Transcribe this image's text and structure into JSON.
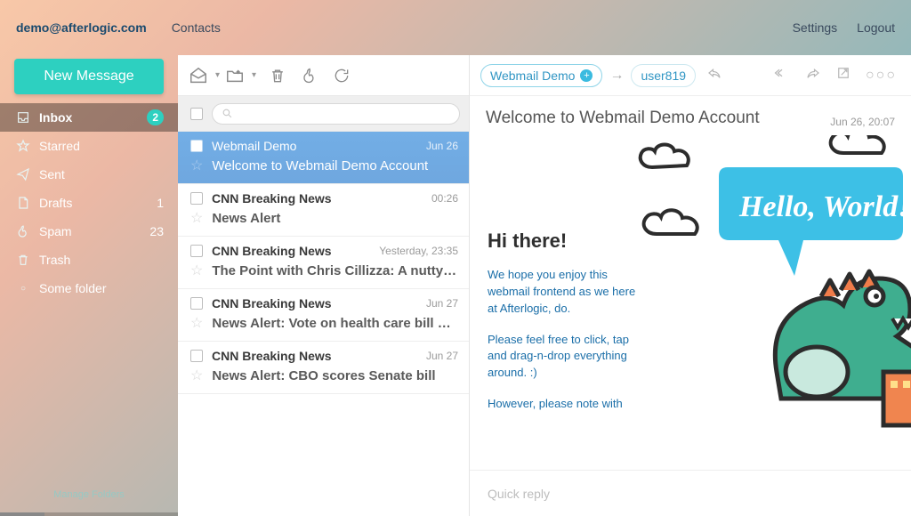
{
  "header": {
    "email": "demo@afterlogic.com",
    "contacts": "Contacts",
    "settings": "Settings",
    "logout": "Logout"
  },
  "sidebar": {
    "new_message": "New Message",
    "manage": "Manage Folders",
    "folders": [
      {
        "icon": "inbox",
        "label": "Inbox",
        "badge": "2",
        "selected": true
      },
      {
        "icon": "star",
        "label": "Starred",
        "badge": "",
        "selected": false
      },
      {
        "icon": "send",
        "label": "Sent",
        "badge": "",
        "selected": false
      },
      {
        "icon": "draft",
        "label": "Drafts",
        "badge": "",
        "count": "1",
        "selected": false
      },
      {
        "icon": "spam",
        "label": "Spam",
        "badge": "",
        "count": "23",
        "selected": false
      },
      {
        "icon": "trash",
        "label": "Trash",
        "badge": "",
        "selected": false
      },
      {
        "icon": "dot",
        "label": "Some folder",
        "badge": "",
        "selected": false
      }
    ]
  },
  "list": {
    "search_placeholder": "",
    "messages": [
      {
        "from": "Webmail Demo",
        "date": "Jun 26",
        "subject": "Welcome to Webmail Demo Account",
        "selected": true
      },
      {
        "from": "CNN Breaking News",
        "date": "00:26",
        "subject": "News Alert",
        "selected": false
      },
      {
        "from": "CNN Breaking News",
        "date": "Yesterday, 23:35",
        "subject": "The Point with Chris Cillizza: A nutty day",
        "selected": false
      },
      {
        "from": "CNN Breaking News",
        "date": "Jun 27",
        "subject": "News Alert: Vote on health care bill delayed",
        "selected": false
      },
      {
        "from": "CNN Breaking News",
        "date": "Jun 27",
        "subject": "News Alert: CBO scores Senate bill",
        "selected": false
      }
    ]
  },
  "reader": {
    "chip1": "Webmail Demo",
    "chip2": "user819",
    "title": "Welcome to Webmail Demo Account",
    "when": "Jun 26, 20:07",
    "bubble": "Hello, World!",
    "greeting": "Hi there!",
    "p1": "We hope you enjoy this webmail frontend as we here at Afterlogic, do.",
    "p2": "Please feel free to click, tap and drag-n-drop everything around. :)",
    "p3": "However, please note with",
    "reply": "Quick reply"
  }
}
